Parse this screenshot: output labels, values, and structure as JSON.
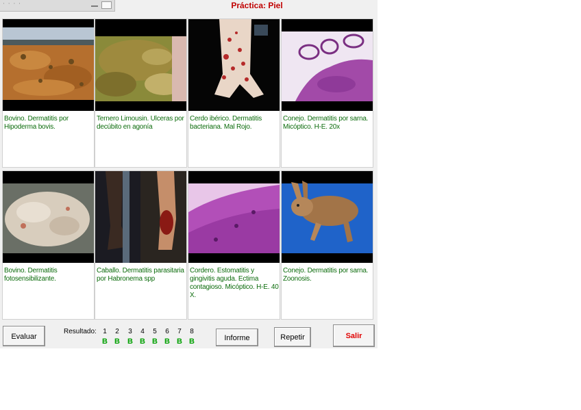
{
  "title": "Práctica: Piel",
  "cards": [
    {
      "caption": "Bovino. Dermatitis por Hipoderma bovis."
    },
    {
      "caption": "Ternero Limousin. Ulceras por decúbito en agonía"
    },
    {
      "caption": "Cerdo ibérico. Dermatitis bacteriana. Mal Rojo."
    },
    {
      "caption": "Conejo. Dermatitis por sarna. Micóptico. H-E. 20x"
    },
    {
      "caption": "Bovino. Dermatitis fotosensibilizante."
    },
    {
      "caption": "Caballo. Dermatitis parasitaria por Habronema spp"
    },
    {
      "caption": "Cordero. Estomatitis y gingivitis aguda. Ectima contagioso. Micóptico. H-E. 40 X."
    },
    {
      "caption": "Conejo. Dermatitis por sarna. Zoonosis."
    }
  ],
  "buttons": {
    "evaluate": "Evaluar",
    "report": "Informe",
    "repeat": "Repetir",
    "exit": "Salir"
  },
  "result": {
    "label": "Resultado:",
    "items": [
      {
        "n": "1",
        "v": "B"
      },
      {
        "n": "2",
        "v": "B"
      },
      {
        "n": "3",
        "v": "B"
      },
      {
        "n": "4",
        "v": "B"
      },
      {
        "n": "5",
        "v": "B"
      },
      {
        "n": "6",
        "v": "B"
      },
      {
        "n": "7",
        "v": "B"
      },
      {
        "n": "8",
        "v": "B"
      }
    ]
  },
  "colors": {
    "title": "#c00000",
    "caption": "#0b6b0b",
    "result_value": "#00a000",
    "exit_button": "#e00000"
  }
}
